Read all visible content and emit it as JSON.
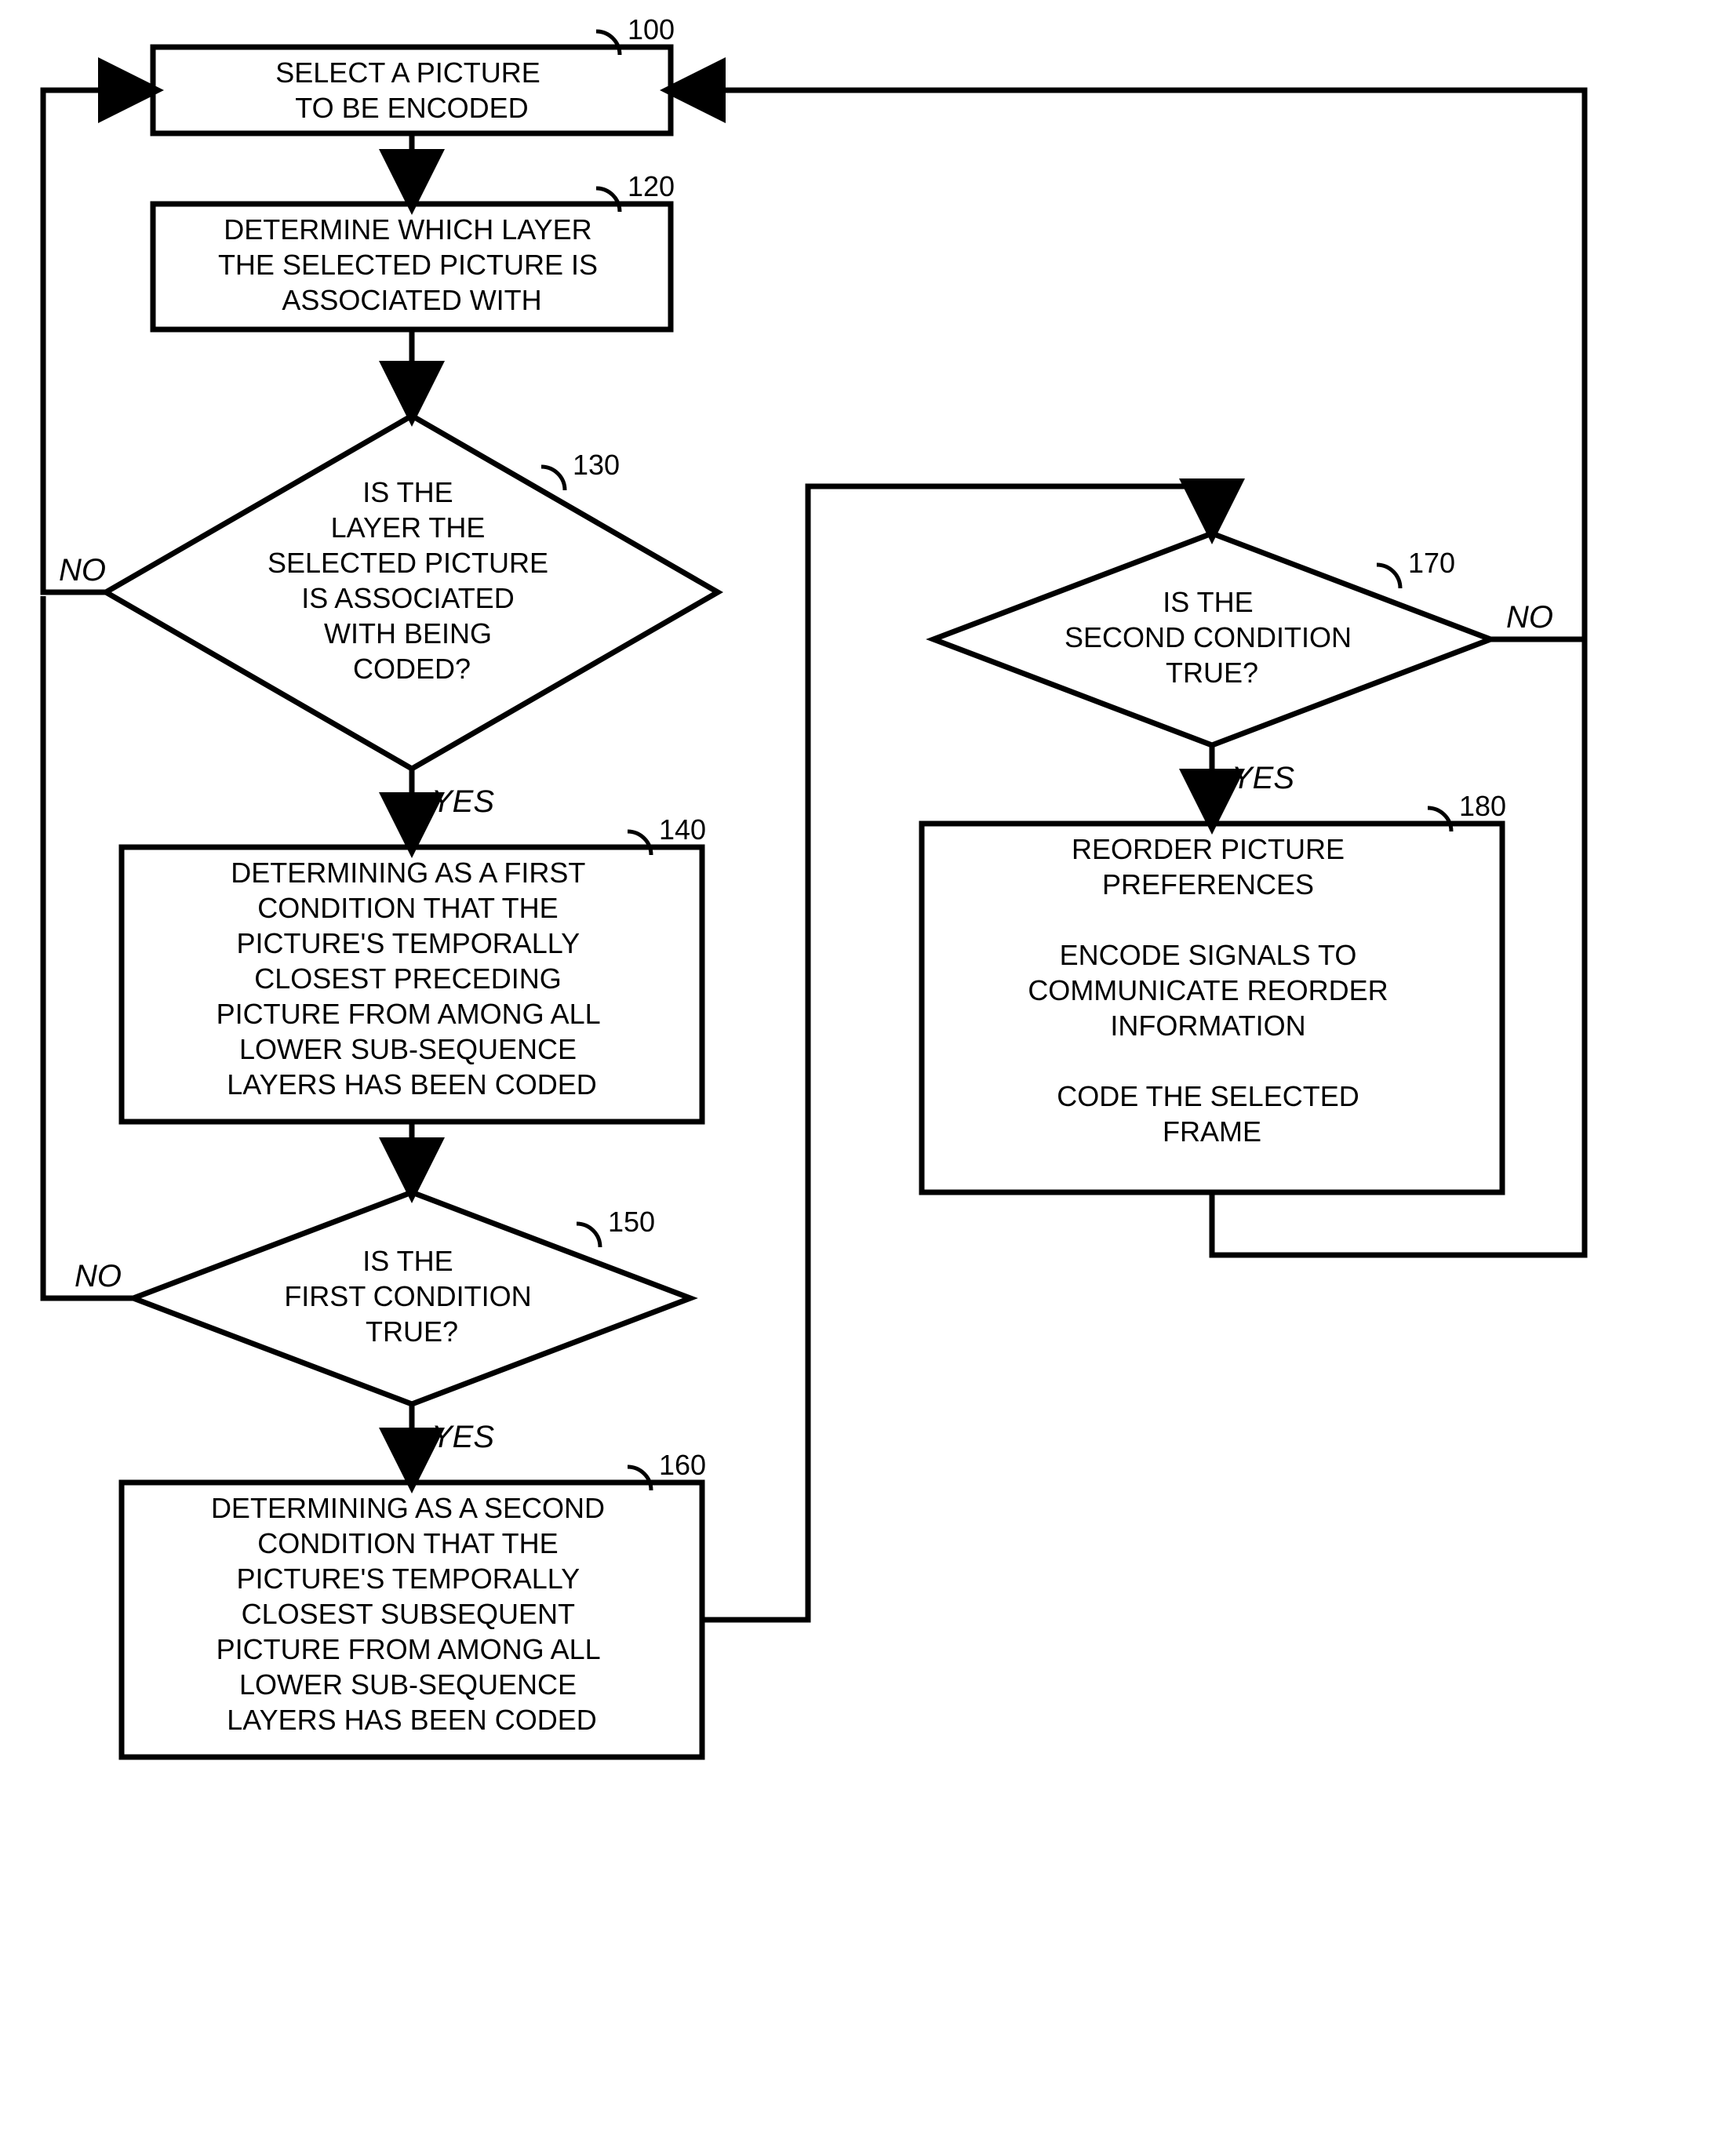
{
  "nodes": {
    "n100": {
      "label": "100",
      "lines": [
        "SELECT A PICTURE",
        "TO BE ENCODED"
      ]
    },
    "n120": {
      "label": "120",
      "lines": [
        "DETERMINE WHICH LAYER",
        "THE SELECTED PICTURE IS",
        "ASSOCIATED WITH"
      ]
    },
    "n130": {
      "label": "130",
      "lines": [
        "IS THE",
        "LAYER THE",
        "SELECTED PICTURE",
        "IS ASSOCIATED",
        "WITH BEING",
        "CODED?"
      ]
    },
    "n140": {
      "label": "140",
      "lines": [
        "DETERMINING AS A FIRST",
        "CONDITION THAT THE",
        "PICTURE'S TEMPORALLY",
        "CLOSEST PRECEDING",
        "PICTURE FROM AMONG ALL",
        "LOWER SUB-SEQUENCE",
        "LAYERS HAS BEEN CODED"
      ]
    },
    "n150": {
      "label": "150",
      "lines": [
        "IS THE",
        "FIRST CONDITION",
        "TRUE?"
      ]
    },
    "n160": {
      "label": "160",
      "lines": [
        "DETERMINING AS A SECOND",
        "CONDITION THAT THE",
        "PICTURE'S TEMPORALLY",
        "CLOSEST SUBSEQUENT",
        "PICTURE FROM AMONG ALL",
        "LOWER SUB-SEQUENCE",
        "LAYERS HAS BEEN CODED"
      ]
    },
    "n170": {
      "label": "170",
      "lines": [
        "IS THE",
        "SECOND CONDITION",
        "TRUE?"
      ]
    },
    "n180": {
      "label": "180",
      "lines": [
        "REORDER PICTURE",
        "PREFERENCES",
        "",
        "ENCODE SIGNALS TO",
        "COMMUNICATE REORDER",
        "INFORMATION",
        "",
        "CODE THE SELECTED",
        "FRAME"
      ]
    }
  },
  "labels": {
    "yes": "YES",
    "no": "NO"
  }
}
